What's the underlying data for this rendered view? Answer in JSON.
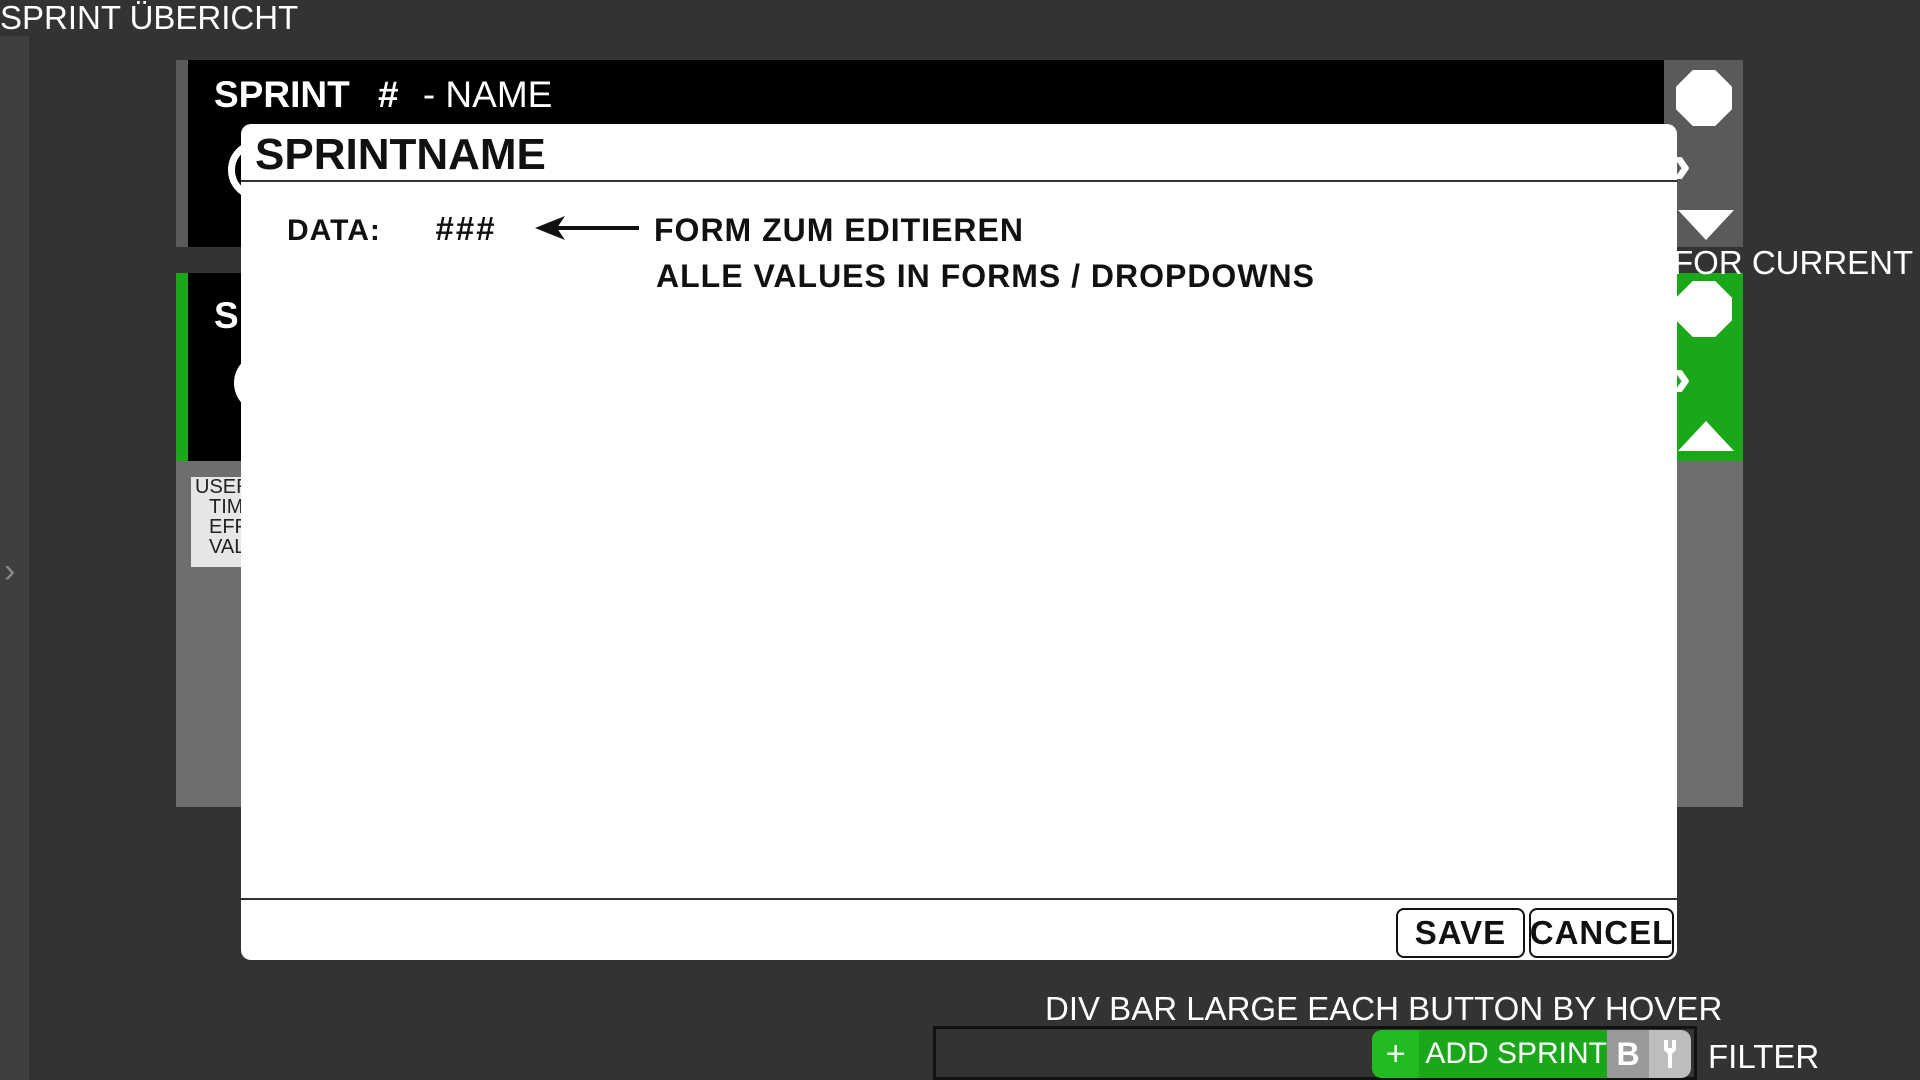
{
  "app": {
    "title": "SPRINT ÜBERICHT"
  },
  "sidebar": {
    "toggle_glyph": "›"
  },
  "sprints": [
    {
      "title_prefix": "SPRINT",
      "title_hash": "#",
      "title_name": "- NAME",
      "status_color": "#5a5a5a"
    },
    {
      "title_prefix": "S",
      "status_color": "#1aa81a"
    }
  ],
  "sprint_detail": {
    "lines": [
      "USER",
      "TIM",
      "EFF",
      "VAL"
    ]
  },
  "annotations": {
    "for_current": "FOR CURRENT",
    "bottom_hint": "DIV BAR LARGE EACH BUTTON BY HOVER",
    "filter": "FILTER"
  },
  "modal": {
    "title": "SPRINTNAME",
    "data_label": "DATA:",
    "data_value": "###",
    "note_line1": "FORM ZUM EDITIEREN",
    "note_line2": "ALLE VALUES IN FORMS / DROPDOWNS",
    "save_label": "SAVE",
    "cancel_label": "CANCEL"
  },
  "toolbar": {
    "add_icon": "+",
    "add_label": "ADD SPRINT",
    "b_label": "B"
  },
  "colors": {
    "background": "#333333",
    "accent_green": "#1aa81a",
    "card_black": "#000000",
    "modal_bg": "#ffffff"
  },
  "icons": [
    "octagon-icon",
    "double-chevron-icon",
    "triangle-down-icon",
    "triangle-up-icon",
    "plus-icon",
    "wrench-icon",
    "chevron-right-icon"
  ]
}
